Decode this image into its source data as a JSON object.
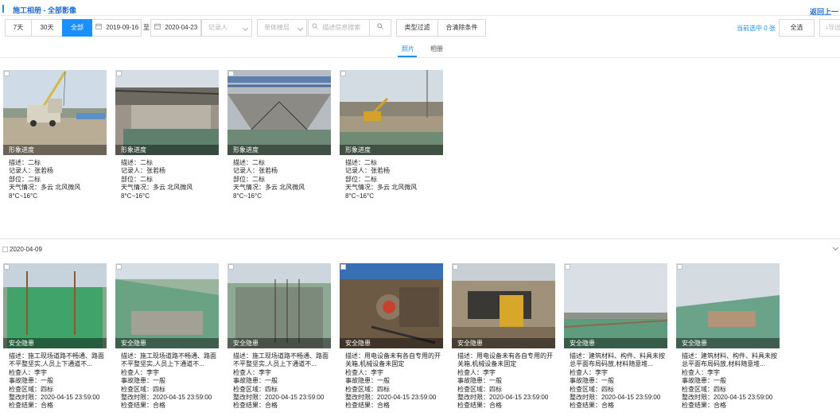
{
  "header": {
    "title": "施工相册 - 全部影像",
    "back_label": "返回上一"
  },
  "toolbar": {
    "range_buttons": [
      "7天",
      "30天",
      "全部"
    ],
    "start_date": "2019-09-16",
    "to_label": "至",
    "end_date": "2020-04-23",
    "recorder_placeholder": "记录人",
    "floor_placeholder": "单体楼层",
    "search_placeholder": "描述信息搜索",
    "type_filter_label": "类型过滤",
    "clear_label": "合清除条件",
    "selected_text": "当前选中 0 张",
    "select_all_label": "全选",
    "export_label": "导出"
  },
  "tabs": {
    "photos": "照片",
    "albums": "相册"
  },
  "progress_cards": [
    {
      "tag": "形象进度",
      "desc": "描述：二标",
      "recorder": "记录人：张若杨",
      "part": "部位：二标",
      "weather": "天气情况：多云 北风微风",
      "temp": "8°C~16°C"
    },
    {
      "tag": "形象进度",
      "desc": "描述：二标",
      "recorder": "记录人：张若杨",
      "part": "部位：二标",
      "weather": "天气情况：多云 北风微风",
      "temp": "8°C~16°C"
    },
    {
      "tag": "形象进度",
      "desc": "描述：二标",
      "recorder": "记录人：张若杨",
      "part": "部位：二标",
      "weather": "天气情况：多云 北风微风",
      "temp": "8°C~16°C"
    },
    {
      "tag": "形象进度",
      "desc": "描述：二标",
      "recorder": "记录人：张若杨",
      "part": "部位：二标",
      "weather": "天气情况：多云 北风微风",
      "temp": "8°C~16°C"
    }
  ],
  "group": {
    "date": "2020-04-09"
  },
  "safety_cards": [
    {
      "tag": "安全隐患",
      "desc": "描述：施工现场道路不畅通、路面不平整坚实,人员上下通道不...",
      "inspector": "检查人：李宇",
      "level": "事故隐患：一般",
      "area": "检查区域：四标",
      "deadline": "整改时限：2020-04-15 23:59:00",
      "result": "检查结果：合格"
    },
    {
      "tag": "安全隐患",
      "desc": "描述：施工现场道路不畅通、路面不平整坚实,人员上下通道不...",
      "inspector": "检查人：李宇",
      "level": "事故隐患：一般",
      "area": "检查区域：四标",
      "deadline": "整改时限：2020-04-15 23:59:00",
      "result": "检查结果：合格"
    },
    {
      "tag": "安全隐患",
      "desc": "描述：施工现场道路不畅通、路面不平整坚实,人员上下通道不...",
      "inspector": "检查人：李宇",
      "level": "事故隐患：一般",
      "area": "检查区域：四标",
      "deadline": "整改时限：2020-04-15 23:59:00",
      "result": "检查结果：合格"
    },
    {
      "tag": "安全隐患",
      "desc": "描述：用电设备未有各自专用的开关箱,机械设备未固定",
      "inspector": "检查人：李宇",
      "level": "事故隐患：一般",
      "area": "检查区域：四标",
      "deadline": "整改时限：2020-04-15 23:59:00",
      "result": "检查结果：合格"
    },
    {
      "tag": "安全隐患",
      "desc": "描述：用电设备未有各自专用的开关箱,机械设备未固定",
      "inspector": "检查人：李宇",
      "level": "事故隐患：一般",
      "area": "检查区域：四标",
      "deadline": "整改时限：2020-04-15 23:59:00",
      "result": "检查结果：合格"
    },
    {
      "tag": "安全隐患",
      "desc": "描述：建筑材料、构件、料具未按总平面布局码放,材料随意堆...",
      "inspector": "检查人：李宇",
      "level": "事故隐患：一般",
      "area": "检查区域：四标",
      "deadline": "整改时限：2020-04-15 23:59:00",
      "result": "检查结果：合格"
    },
    {
      "tag": "安全隐患",
      "desc": "描述：建筑材料、构件、料具未按总平面布局码放,材料随意堆...",
      "inspector": "检查人：李宇",
      "level": "事故隐患：一般",
      "area": "检查区域：四标",
      "deadline": "整改时限：2020-04-15 23:59:00",
      "result": "检查结果：合格"
    }
  ],
  "colors": {
    "accent": "#1890ff",
    "title": "#1f6fcf"
  }
}
